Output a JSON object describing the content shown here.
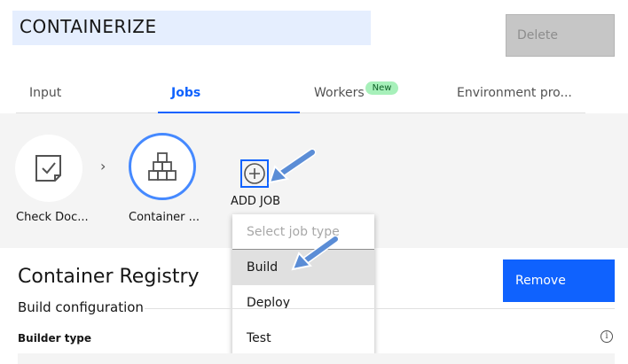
{
  "header": {
    "title": "CONTAINERIZE",
    "delete_label": "Delete"
  },
  "tabs": [
    {
      "label": "Input"
    },
    {
      "label": "Jobs"
    },
    {
      "label": "Workers",
      "badge": "New"
    },
    {
      "label": "Environment pro..."
    }
  ],
  "jobs": {
    "items": [
      {
        "label": "Check Doc...",
        "icon": "document-check-icon"
      },
      {
        "label": "Container ...",
        "icon": "boxes-stack-icon"
      }
    ],
    "add_label": "ADD JOB"
  },
  "dropdown": {
    "placeholder": "Select job type",
    "options": [
      "Build",
      "Deploy",
      "Test"
    ],
    "highlighted": "Build"
  },
  "section": {
    "title": "Container Registry",
    "remove_label": "Remove",
    "subtitle": "Build configuration",
    "builder_label": "Builder type",
    "info_glyph": "i"
  },
  "colors": {
    "accent": "#0f62fe",
    "selected_ring": "#4589ff",
    "badge_bg": "#a7f0ba",
    "arrow": "#5b8dd6"
  }
}
